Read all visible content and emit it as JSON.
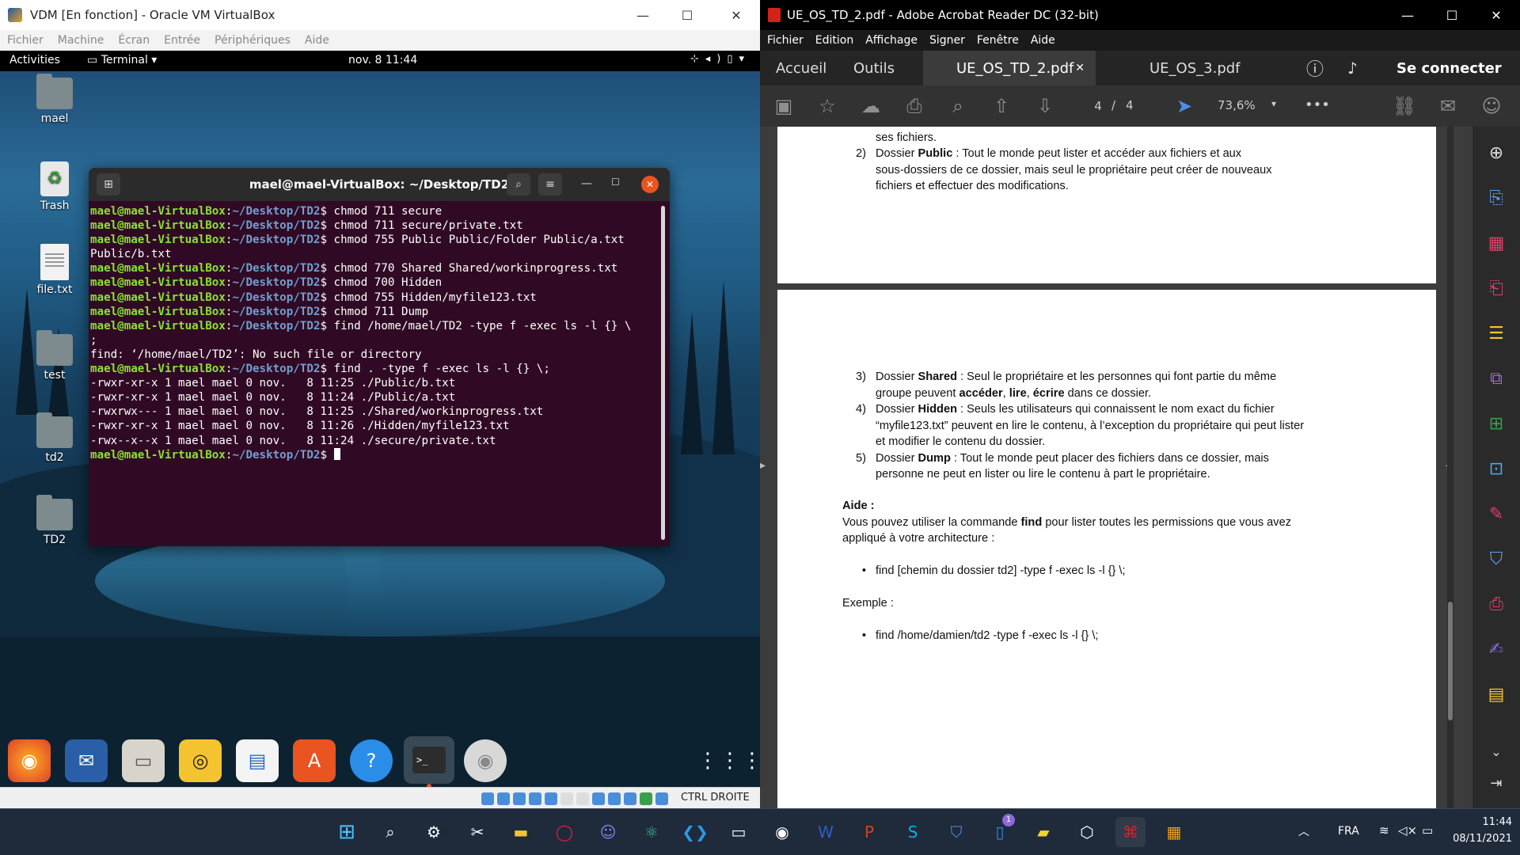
{
  "vbox": {
    "title": "VDM [En fonction] - Oracle VM VirtualBox",
    "menu": [
      "Fichier",
      "Machine",
      "Écran",
      "Entrée",
      "Périphériques",
      "Aide"
    ],
    "status_key": "CTRL DROITE"
  },
  "gnome": {
    "activities": "Activities",
    "app_menu": "Terminal ▾",
    "clock": "nov. 8  11:44"
  },
  "desktop_icons": [
    "mael",
    "Trash",
    "file.txt",
    "test",
    "td2",
    "TD2"
  ],
  "terminal": {
    "title": "mael@mael-VirtualBox: ~/Desktop/TD2",
    "user": "mael@mael-VirtualBox",
    "path": "~/Desktop/TD2",
    "commands": [
      "chmod 711 secure",
      "chmod 711 secure/private.txt",
      "chmod 755 Public Public/Folder Public/a.txt",
      "chmod 770 Shared Shared/workinprogress.txt",
      "chmod 700 Hidden",
      "chmod 755 Hidden/myfile123.txt",
      "chmod 711 Dump",
      "find /home/mael/TD2 -type f -exec ls -l {} \\",
      "find . -type f -exec ls -l {} \\;"
    ],
    "wrap_public": "Public/b.txt",
    "wrap_semicolon": ";",
    "error": "find: ‘/home/mael/TD2’: No such file or directory",
    "listing": [
      "-rwxr-xr-x 1 mael mael 0 nov.   8 11:25 ./Public/b.txt",
      "-rwxr-xr-x 1 mael mael 0 nov.   8 11:24 ./Public/a.txt",
      "-rwxrwx--- 1 mael mael 0 nov.   8 11:25 ./Shared/workinprogress.txt",
      "-rwxr-xr-x 1 mael mael 0 nov.   8 11:26 ./Hidden/myfile123.txt",
      "-rwx--x--x 1 mael mael 0 nov.   8 11:24 ./secure/private.txt"
    ]
  },
  "acrobat": {
    "title": "UE_OS_TD_2.pdf - Adobe Acrobat Reader DC (32-bit)",
    "menu": [
      "Fichier",
      "Edition",
      "Affichage",
      "Signer",
      "Fenêtre",
      "Aide"
    ],
    "nav_home": "Accueil",
    "nav_tools": "Outils",
    "tab_active": "UE_OS_TD_2.pdf",
    "tab_other": "UE_OS_3.pdf",
    "sign_in": "Se connecter",
    "page_current": "4",
    "page_sep": "/",
    "page_total": "4",
    "zoom": "73,6%",
    "more": "•••",
    "page1": {
      "top_line": "ses fichiers.",
      "item2_num": "2)",
      "item2_a": "Dossier ",
      "item2_b": "Public",
      "item2_c": " : Tout le monde peut lister et accéder aux fichiers et aux",
      "item2_d": "sous-dossiers de ce dossier, mais seul le propriétaire peut créer de nouveaux",
      "item2_e": "fichiers et effectuer des modifications."
    },
    "page2": {
      "item3_num": "3)",
      "item3_a": "Dossier ",
      "item3_b": "Shared",
      "item3_c": " : Seul le propriétaire et les personnes qui font partie du même",
      "item3_d": "groupe peuvent ",
      "item3_e": "accéder",
      "item3_f": ", ",
      "item3_g": "lire",
      "item3_h": ", ",
      "item3_i": "écrire",
      "item3_j": " dans ce dossier.",
      "item4_num": "4)",
      "item4_a": "Dossier ",
      "item4_b": "Hidden",
      "item4_c": " : Seuls les utilisateurs qui connaissent le nom exact du fichier",
      "item4_d": "“myfile123.txt” peuvent en lire le contenu, à l’exception du propriétaire qui peut lister",
      "item4_e": "et modifier le contenu du dossier.",
      "item5_num": "5)",
      "item5_a": "Dossier ",
      "item5_b": "Dump",
      "item5_c": " : Tout le monde peut placer des fichiers dans ce dossier, mais",
      "item5_d": "personne ne peut en lister ou lire le contenu à part le propriétaire.",
      "aide_title": "Aide :",
      "aide_a": "Vous pouvez utiliser la commande ",
      "aide_b": "find",
      "aide_c": " pour lister toutes les permissions que vous avez",
      "aide_d": "appliqué à votre architecture :",
      "bullet1": "find [chemin du dossier td2] -type f -exec ls -l {} \\;",
      "exemple": "Exemple :",
      "bullet2": "find /home/damien/td2 -type f -exec ls -l {} \\;"
    }
  },
  "taskbar": {
    "lang": "FRA",
    "time": "11:44",
    "date": "08/11/2021",
    "badge": "1"
  }
}
